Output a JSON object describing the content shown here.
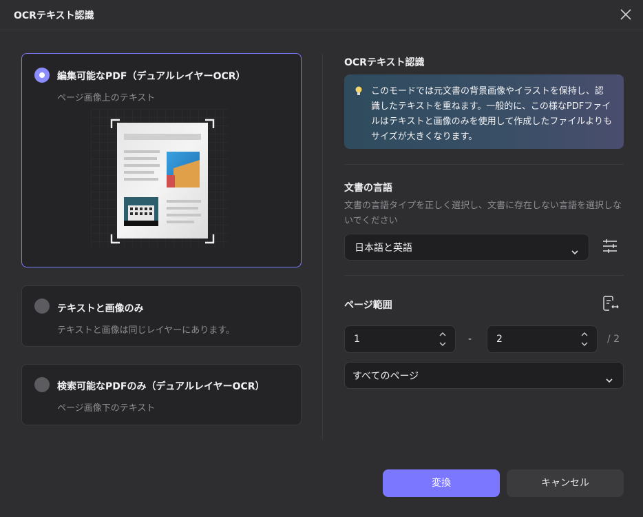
{
  "window": {
    "title": "OCRテキスト認識"
  },
  "options": [
    {
      "title": "編集可能なPDF（デュアルレイヤーOCR）",
      "subtitle": "ページ画像上のテキスト",
      "selected": true
    },
    {
      "title": "テキストと画像のみ",
      "subtitle": "テキストと画像は同じレイヤーにあります。",
      "selected": false
    },
    {
      "title": "検索可能なPDFのみ（デュアルレイヤーOCR）",
      "subtitle": "ページ画像下のテキスト",
      "selected": false
    }
  ],
  "ocr_section": {
    "title": "OCRテキスト認識",
    "info": "このモードでは元文書の背景画像やイラストを保持し、認識したテキストを重ねます。一般的に、この様なPDFファイルはテキストと画像のみを使用して作成したファイルよりもサイズが大きくなります。"
  },
  "language_section": {
    "title": "文書の言語",
    "description": "文書の言語タイプを正しく選択し、文書に存在しない言語を選択しないでください",
    "selected": "日本語と英語"
  },
  "page_range": {
    "title": "ページ範囲",
    "from": "1",
    "separator": "-",
    "to": "2",
    "total": "/ 2",
    "mode": "すべてのページ"
  },
  "buttons": {
    "convert": "変換",
    "cancel": "キャンセル"
  },
  "colors": {
    "accent": "#7b78ff",
    "selected_border": "#7b7dff",
    "background": "#2e2e30"
  },
  "icons": [
    "close-icon",
    "radio-icon",
    "bulb-icon",
    "chevron-down-icon",
    "settings-sliders-icon",
    "page-range-icon",
    "stepper-arrows-icon"
  ]
}
